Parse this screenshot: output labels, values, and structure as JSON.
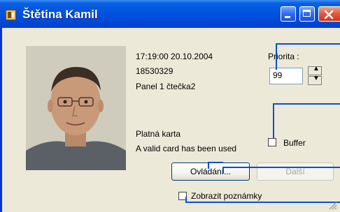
{
  "window": {
    "title": "Štětina Kamil"
  },
  "event": {
    "timestamp": "17:19:00 20.10.2004",
    "card_number": "18530329",
    "reader": "Panel 1 čtečka2",
    "card_status": "Platná karta",
    "card_status_en": "A valid card has been used"
  },
  "priority": {
    "label": "Priorita :",
    "value": "99"
  },
  "buffer": {
    "label": "Buffer",
    "checked": false
  },
  "buttons": {
    "control_label": "Ovládání...",
    "next_label": "Další"
  },
  "notes": {
    "label": "Zobrazit poznámky",
    "checked": false
  },
  "colors": {
    "titlebar": "#0052e0",
    "window_bg": "#ece9d8",
    "callout_line": "#0a4fd6",
    "close_button": "#e2573b"
  }
}
